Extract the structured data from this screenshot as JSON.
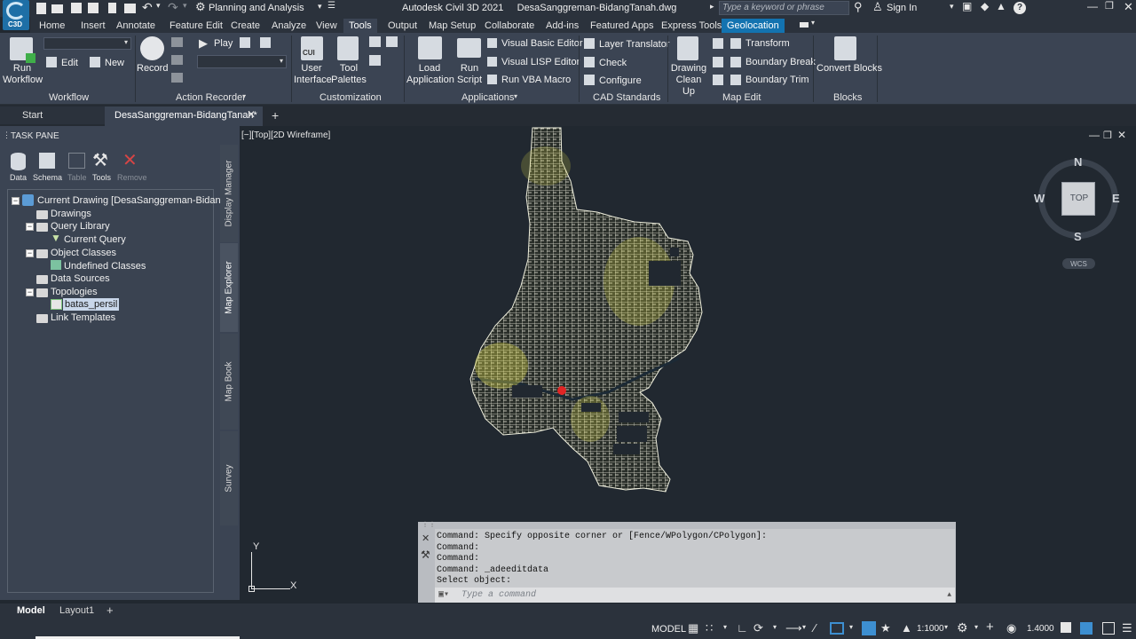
{
  "app": {
    "logo_text": "C3D",
    "title": "Autodesk Civil 3D 2021",
    "document": "DesaSanggreman-BidangTanah.dwg",
    "workspace": "Planning and Analysis",
    "search_placeholder": "Type a keyword or phrase",
    "sign_in": "Sign In"
  },
  "ribbon_tabs": [
    "Home",
    "Insert",
    "Annotate",
    "Feature Edit",
    "Create",
    "Analyze",
    "View",
    "Tools",
    "Output",
    "Map Setup",
    "Collaborate",
    "Add-ins",
    "Featured Apps",
    "Express Tools",
    "Geolocation"
  ],
  "active_tab": "Tools",
  "ribbon": {
    "workflow": {
      "run": "Run Workflow",
      "edit": "Edit",
      "new": "New",
      "label": "Workflow"
    },
    "action_recorder": {
      "record": "Record",
      "play": "Play",
      "label": "Action Recorder"
    },
    "customization": {
      "user_interface": "User Interface",
      "tool_palettes": "Tool Palettes",
      "label": "Customization",
      "cui_badge": "CUI"
    },
    "applications": {
      "load": "Load Application",
      "run_script": "Run Script",
      "vbe": "Visual Basic Editor",
      "vlisp": "Visual LISP Editor",
      "vba": "Run VBA Macro",
      "label": "Applications"
    },
    "cad_standards": {
      "layer_translator": "Layer Translator",
      "check": "Check",
      "configure": "Configure",
      "label": "CAD Standards"
    },
    "map_edit": {
      "cleanup": "Drawing Clean Up",
      "transform": "Transform",
      "boundary_break": "Boundary Break",
      "boundary_trim": "Boundary Trim",
      "label": "Map Edit"
    },
    "blocks": {
      "convert": "Convert Blocks",
      "label": "Blocks"
    }
  },
  "doc_tabs": [
    "Start",
    "DesaSanggreman-BidangTanah*"
  ],
  "task_pane": {
    "title": "TASK PANE",
    "tools": [
      "Data",
      "Schema",
      "Table",
      "Tools",
      "Remove"
    ],
    "tree": [
      "Current Drawing [DesaSanggreman-BidangTa",
      "Drawings",
      "Query Library",
      "Current Query",
      "Object Classes",
      "Undefined Classes",
      "Data Sources",
      "Topologies",
      "batas_persil",
      "Link Templates"
    ],
    "side_tabs": [
      "Display Manager",
      "Map Explorer",
      "Map Book",
      "Survey"
    ]
  },
  "viewport": {
    "label": "[−][Top][2D Wireframe]",
    "viewcube": {
      "n": "N",
      "s": "S",
      "e": "E",
      "w": "W",
      "top": "TOP",
      "wcs": "WCS"
    },
    "ucs": {
      "x": "X",
      "y": "Y"
    }
  },
  "command": {
    "history": [
      "Command: Specify opposite corner or [Fence/WPolygon/CPolygon]:",
      "Command:",
      "Command:",
      "Command: _adeeditdata",
      "Select object:"
    ],
    "placeholder": "Type a command"
  },
  "layout_tabs": [
    "Model",
    "Layout1"
  ],
  "status": {
    "model": "MODEL",
    "scale": "1:1000",
    "precision": "1.4000"
  }
}
